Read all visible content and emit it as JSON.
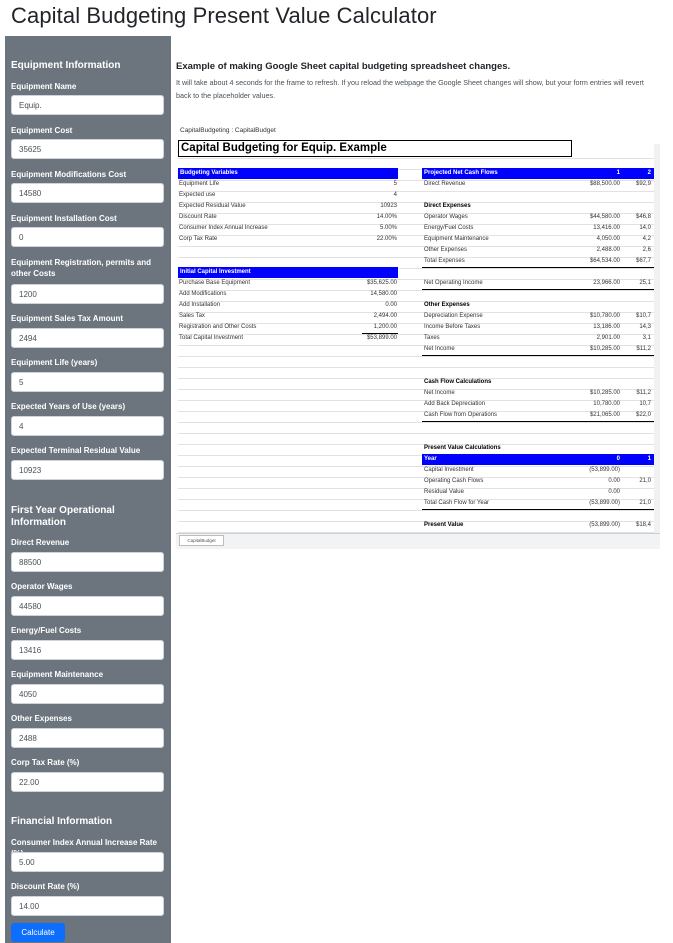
{
  "page": {
    "title": "Capital Budgeting Present Value Calculator"
  },
  "sidebar": {
    "equipment_section": "Equipment Information",
    "operational_section": "First Year Operational Information",
    "financial_section": "Financial Information",
    "fields": {
      "equipment_name": {
        "label": "Equipment Name",
        "value": "Equip."
      },
      "equipment_cost": {
        "label": "Equipment Cost",
        "value": "35625"
      },
      "modifications_cost": {
        "label": "Equipment Modifications Cost",
        "value": "14580"
      },
      "installation_cost": {
        "label": "Equipment Installation Cost",
        "value": "0"
      },
      "registration_cost": {
        "label": "Equipment Registration, permits and other Costs",
        "value": "1200"
      },
      "sales_tax": {
        "label": "Equipment Sales Tax Amount",
        "value": "2494"
      },
      "equipment_life": {
        "label": "Equipment Life (years)",
        "value": "5"
      },
      "years_of_use": {
        "label": "Expected Years of Use (years)",
        "value": "4"
      },
      "residual_value": {
        "label": "Expected Terminal Residual Value",
        "value": "10923"
      },
      "direct_revenue": {
        "label": "Direct Revenue",
        "value": "88500"
      },
      "operator_wages": {
        "label": "Operator Wages",
        "value": "44580"
      },
      "energy_fuel": {
        "label": "Energy/Fuel Costs",
        "value": "13416"
      },
      "maintenance": {
        "label": "Equipment Maintenance",
        "value": "4050"
      },
      "other_expenses": {
        "label": "Other Expenses",
        "value": "2488"
      },
      "corp_tax_rate": {
        "label": "Corp Tax Rate (%)",
        "value": "22.00"
      },
      "cpi_rate": {
        "label": "Consumer Index Annual Increase Rate (%)",
        "value": "5.00"
      },
      "discount_rate": {
        "label": "Discount Rate (%)",
        "value": "14.00"
      }
    },
    "calculate_label": "Calculate"
  },
  "intro": {
    "title": "Example of making Google Sheet capital budgeting spreadsheet changes.",
    "body": "It will take about 4 seconds for the frame to refresh. If you reload the webpage the Google Sheet changes will show, but your form entries will revert back to the placeholder values."
  },
  "sheet": {
    "path": "CapitalBudgeting : CapitalBudget",
    "heading": "Capital Budgeting for Equip. Example",
    "tab_label": "CapitalBudget",
    "budgeting_variables": {
      "header": "Budgeting Variables",
      "rows": [
        {
          "label": "Equipment Life",
          "value": "5"
        },
        {
          "label": "Expected use",
          "value": "4"
        },
        {
          "label": "Expected Residual Value",
          "value": "10923"
        },
        {
          "label": "Discount Rate",
          "value": "14.00%"
        },
        {
          "label": "Consumer Index Annual Increase",
          "value": "5.00%"
        },
        {
          "label": "Corp Tax Rate",
          "value": "22.00%"
        }
      ]
    },
    "initial_investment": {
      "header": "Initial Capital Investment",
      "rows": [
        {
          "label": "Purchase Base Equipment",
          "value": "$35,625.00"
        },
        {
          "label": "Add Modifications",
          "value": "14,580.00"
        },
        {
          "label": "Add Installation",
          "value": "0.00"
        },
        {
          "label": "Sales Tax",
          "value": "2,494.00"
        },
        {
          "label": "Registration and Other Costs",
          "value": "1,200.00"
        },
        {
          "label": "Total Capital Investment",
          "value": "$53,899.00"
        }
      ]
    },
    "projected": {
      "header": "Projected Net Cash Flows",
      "col1": "1",
      "col2": "2",
      "direct_revenue": {
        "label": "Direct Revenue",
        "v1": "$88,500.00",
        "v2": "$92,9"
      },
      "direct_expenses_header": "Direct Expenses",
      "expenses": [
        {
          "label": "Operator Wages",
          "v1": "$44,580.00",
          "v2": "$46,8"
        },
        {
          "label": "Energy/Fuel Costs",
          "v1": "13,416.00",
          "v2": "14,0"
        },
        {
          "label": "Equipment Maintenance",
          "v1": "4,050.00",
          "v2": "4,2"
        },
        {
          "label": "Other Expenses",
          "v1": "2,488.00",
          "v2": "2,6"
        },
        {
          "label": "Total Expenses",
          "v1": "$64,534.00",
          "v2": "$67,7"
        }
      ],
      "net_operating": {
        "label": "Net Operating Income",
        "v1": "23,966.00",
        "v2": "25,1"
      },
      "other_expenses_header": "Other Expenses",
      "other": [
        {
          "label": "Depreciation Expense",
          "v1": "$10,780.00",
          "v2": "$10,7"
        },
        {
          "label": "Income Before Taxes",
          "v1": "13,186.00",
          "v2": "14,3"
        },
        {
          "label": "Taxes",
          "v1": "2,901.00",
          "v2": "3,1"
        },
        {
          "label": "Net Income",
          "v1": "$10,285.00",
          "v2": "$11,2"
        }
      ],
      "cash_flow_header": "Cash Flow Calculations",
      "cash_flow": [
        {
          "label": "Net Income",
          "v1": "$10,285.00",
          "v2": "$11,2"
        },
        {
          "label": "Add Back Depreciation",
          "v1": "10,780.00",
          "v2": "10,7"
        },
        {
          "label": "Cash Flow from Operations",
          "v1": "$21,065.00",
          "v2": "$22,0"
        }
      ],
      "pv_header": "Present Value Calculations",
      "year_label": "Year",
      "year0": "0",
      "year1": "1",
      "pv_rows": [
        {
          "label": "Capital Investment",
          "v0": "(53,899.00)",
          "v1": ""
        },
        {
          "label": "Operating Cash Flows",
          "v0": "0.00",
          "v1": "21,0"
        },
        {
          "label": "Residual Value",
          "v0": "0.00",
          "v1": ""
        },
        {
          "label": "Total Cash Flow for Year",
          "v0": "(53,899.00)",
          "v1": "21,0"
        }
      ],
      "present_value": {
        "label": "Present Value",
        "v0": "(53,899.00)",
        "v1": "$18,4"
      }
    }
  }
}
